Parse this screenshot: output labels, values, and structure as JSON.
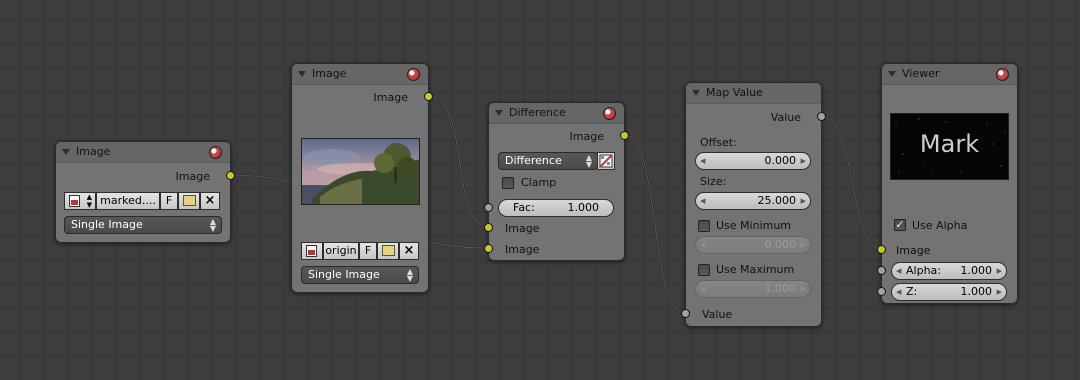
{
  "nodes": {
    "image1": {
      "title": "Image",
      "output_label": "Image",
      "filename": "marked....",
      "f_label": "F",
      "source": "Single Image"
    },
    "image2": {
      "title": "Image",
      "output_label": "Image",
      "filename": "origin",
      "f_label": "F",
      "source": "Single Image"
    },
    "difference": {
      "title": "Difference",
      "output_label": "Image",
      "blend_mode": "Difference",
      "clamp_label": "Clamp",
      "clamp_checked": false,
      "fac_label": "Fac:",
      "fac_value": "1.000",
      "input1_label": "Image",
      "input2_label": "Image"
    },
    "map_value": {
      "title": "Map Value",
      "output_label": "Value",
      "offset_label": "Offset:",
      "offset_value": "0.000",
      "size_label": "Size:",
      "size_value": "25.000",
      "use_min_label": "Use Minimum",
      "min_value": "0.000",
      "use_max_label": "Use Maximum",
      "max_value": "1.000",
      "input_label": "Value"
    },
    "viewer": {
      "title": "Viewer",
      "preview_text": "Mark",
      "use_alpha_label": "Use Alpha",
      "use_alpha_checked": "✓",
      "input_label": "Image",
      "alpha_label": "Alpha:",
      "alpha_value": "1.000",
      "z_label": "Z:",
      "z_value": "1.000"
    }
  },
  "colors": {
    "socket_color": "#c7c729",
    "socket_value": "#a1a1a1",
    "link": "#2b2b2b",
    "node_body": "#737373",
    "grid_bg": "#3d3d3d"
  },
  "icons": [
    "collapse-triangle-icon",
    "preview-sphere-icon",
    "image-browse-icon",
    "folder-icon",
    "close-x-icon",
    "color-ramp-icon",
    "checkbox-check-icon"
  ]
}
